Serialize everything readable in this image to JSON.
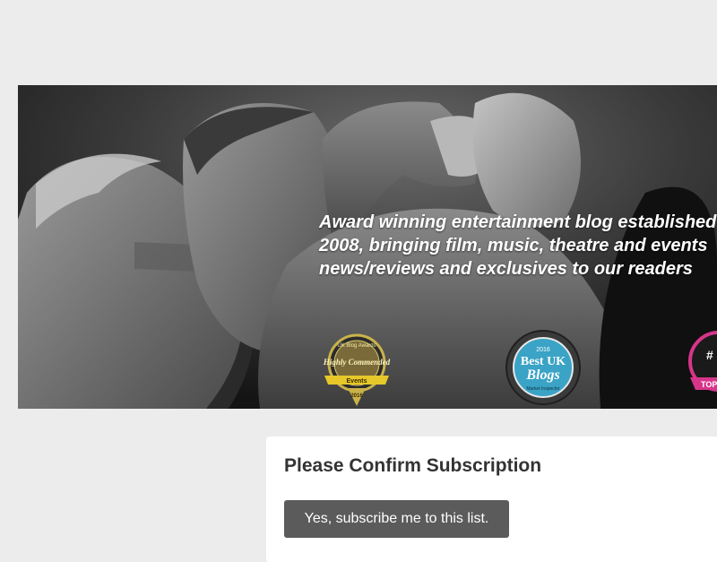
{
  "banner": {
    "tagline_lines": [
      "Award winning entertainment blog established in",
      "2008, bringing film, music, theatre and events",
      "news/reviews and exclusives to our readers"
    ],
    "badges": {
      "award": {
        "top": "UK Blog Awards",
        "main": "Highly Commended",
        "ribbon": "Events",
        "year": "2016"
      },
      "blogs": {
        "year": "2016",
        "title_top": "Best UK",
        "title_bottom": "Blogs",
        "sub": "Market Inspector"
      },
      "top": {
        "label": "TOP",
        "hash": "#"
      }
    }
  },
  "subscription": {
    "title": "Please Confirm Subscription",
    "button_label": "Yes, subscribe me to this list."
  }
}
